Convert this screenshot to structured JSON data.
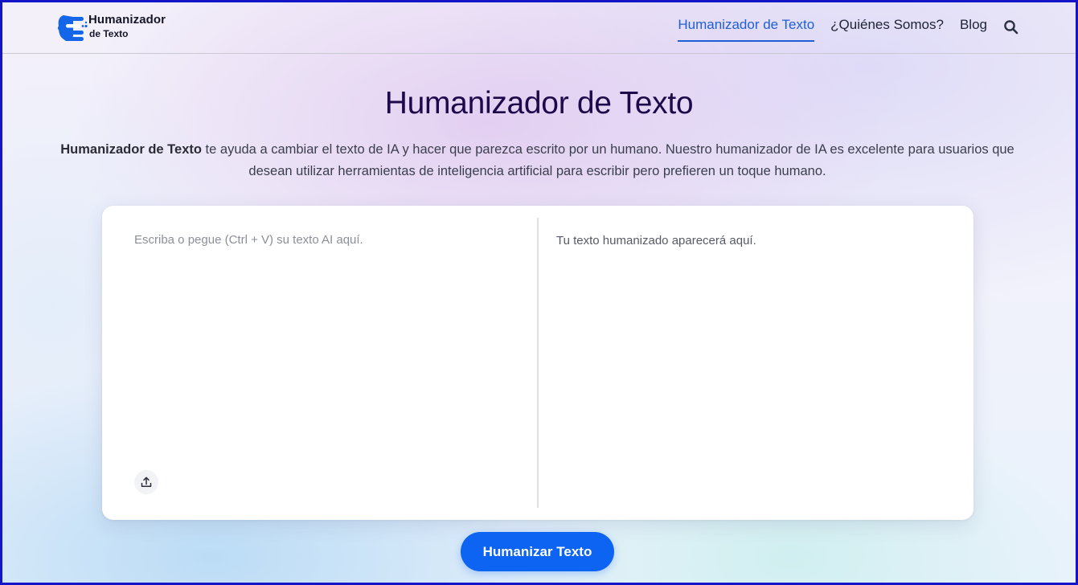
{
  "header": {
    "logo": {
      "line1": "Humanizador",
      "line2": "de Texto"
    },
    "nav": [
      {
        "label": "Humanizador de Texto",
        "active": true
      },
      {
        "label": "¿Quiénes Somos?",
        "active": false
      },
      {
        "label": "Blog",
        "active": false
      }
    ],
    "search_icon": "search-icon"
  },
  "main": {
    "title": "Humanizador de Texto",
    "description_bold": "Humanizador de Texto",
    "description_rest": " te ayuda a cambiar el texto de IA y hacer que parezca escrito por un humano. Nuestro humanizador de IA es excelente para usuarios que desean utilizar herramientas de inteligencia artificial para escribir pero prefieren un toque humano."
  },
  "editor": {
    "input_value": "",
    "input_placeholder": "Escriba o pegue (Ctrl + V) su texto AI aquí.",
    "output_placeholder": "Tu texto humanizado aparecerá aquí.",
    "upload_icon": "upload-icon"
  },
  "actions": {
    "humanize_label": "Humanizar Texto"
  },
  "colors": {
    "accent": "#0d63f2",
    "title": "#1e0a4a",
    "nav_active": "#1f5fd6",
    "frame_border": "#1515c8"
  }
}
